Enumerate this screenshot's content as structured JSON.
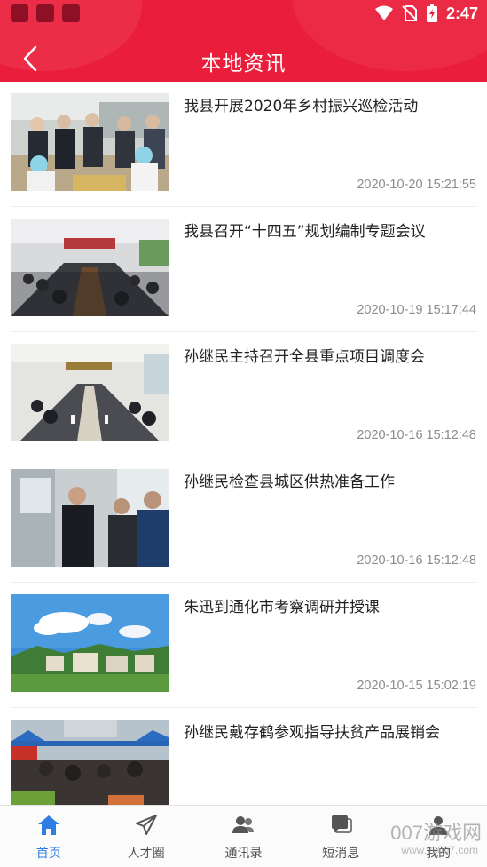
{
  "status_bar": {
    "time": "2:47"
  },
  "header": {
    "title": "本地资讯",
    "back_icon": "chevron-left-icon"
  },
  "news": [
    {
      "title": "我县开展2020年乡村振兴巡检活动",
      "time": "2020-10-20 15:21:55"
    },
    {
      "title": "我县召开“十四五”规划编制专题会议",
      "time": "2020-10-19 15:17:44"
    },
    {
      "title": "孙继民主持召开全县重点项目调度会",
      "time": "2020-10-16 15:12:48"
    },
    {
      "title": "孙继民检查县城区供热准备工作",
      "time": "2020-10-16 15:12:48"
    },
    {
      "title": "朱迅到通化市考察调研并授课",
      "time": "2020-10-15 15:02:19"
    },
    {
      "title": "孙继民戴存鹤参观指导扶贫产品展销会",
      "time": ""
    }
  ],
  "tabs": [
    {
      "label": "首页",
      "icon": "home-icon",
      "active": true
    },
    {
      "label": "人才圈",
      "icon": "send-icon",
      "active": false
    },
    {
      "label": "通讯录",
      "icon": "contacts-icon",
      "active": false
    },
    {
      "label": "短消息",
      "icon": "message-icon",
      "active": false
    },
    {
      "label": "我的",
      "icon": "user-icon",
      "active": false
    }
  ],
  "colors": {
    "header": "#ea1e3a",
    "tab_active": "#2f7de1"
  },
  "watermark": {
    "text": "007游戏网",
    "sub": "www.yx007.com"
  }
}
